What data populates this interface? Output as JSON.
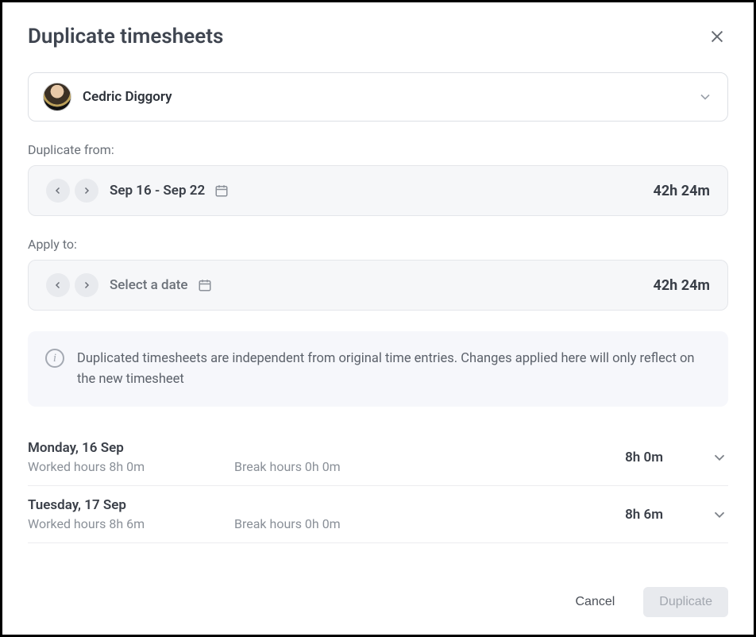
{
  "title": "Duplicate timesheets",
  "user": {
    "name": "Cedric Diggory"
  },
  "duplicate_from": {
    "label": "Duplicate from:",
    "range": "Sep 16 - Sep 22",
    "total": "42h 24m"
  },
  "apply_to": {
    "label": "Apply to:",
    "placeholder": "Select a date",
    "total": "42h 24m"
  },
  "info": "Duplicated timesheets are independent from original time entries. Changes applied here will only reflect on the new timesheet",
  "days": [
    {
      "name": "Monday, 16 Sep",
      "worked": "Worked hours 8h 0m",
      "break": "Break hours 0h 0m",
      "total": "8h 0m"
    },
    {
      "name": "Tuesday, 17 Sep",
      "worked": "Worked hours 8h 6m",
      "break": "Break hours 0h 0m",
      "total": "8h 6m"
    }
  ],
  "footer": {
    "cancel": "Cancel",
    "duplicate": "Duplicate"
  }
}
